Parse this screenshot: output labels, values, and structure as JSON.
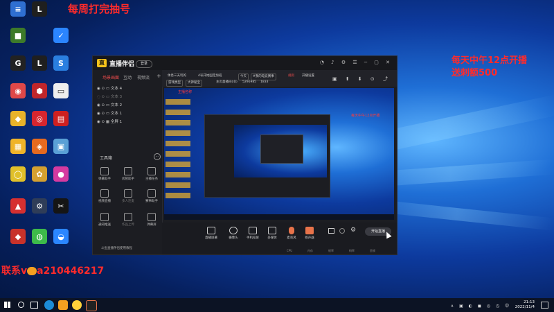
{
  "overlays": {
    "top_text": "每周打完抽号",
    "right_line1": "每天中午12点开播",
    "right_line2": "送刺额500",
    "bottom_prefix": "联系v",
    "bottom_suffix": "a210446217"
  },
  "desktop_icons": [
    {
      "label": "",
      "color": "#2f6fd1",
      "glyph": "≡"
    },
    {
      "label": "",
      "color": "#1f1f1f",
      "glyph": "L"
    },
    {
      "label": "",
      "color": "#3d7a2a",
      "glyph": "■"
    },
    {
      "label": "",
      "color": "#2b85ff",
      "glyph": "✓"
    },
    {
      "label": "",
      "color": "#222222",
      "glyph": "G"
    },
    {
      "label": "",
      "color": "#1f1f1f",
      "glyph": "L"
    },
    {
      "label": "",
      "color": "#2a7fe0",
      "glyph": "S"
    },
    {
      "label": "",
      "color": "#e04848",
      "glyph": "◉"
    },
    {
      "label": "",
      "color": "#c0262b",
      "glyph": "⬢"
    },
    {
      "label": "",
      "color": "#eeeeee",
      "glyph": "▭"
    },
    {
      "label": "",
      "color": "#e8b22a",
      "glyph": "◆"
    },
    {
      "label": "",
      "color": "#d6262f",
      "glyph": "◎"
    },
    {
      "label": "",
      "color": "#ce2020",
      "glyph": "▤"
    },
    {
      "label": "",
      "color": "#f0b429",
      "glyph": "▦"
    },
    {
      "label": "",
      "color": "#e66a1f",
      "glyph": "◈"
    },
    {
      "label": "",
      "color": "#5aa0d6",
      "glyph": "▣"
    },
    {
      "label": "",
      "color": "#e0c02a",
      "glyph": "◯"
    },
    {
      "label": "",
      "color": "#d4a030",
      "glyph": "✿"
    },
    {
      "label": "",
      "color": "#d63aa0",
      "glyph": "●"
    },
    {
      "label": "",
      "color": "#d63030",
      "glyph": "▲"
    },
    {
      "label": "",
      "color": "#2f3d58",
      "glyph": "⚙"
    },
    {
      "label": "",
      "color": "#151515",
      "glyph": "✂"
    },
    {
      "label": "",
      "color": "#c8322a",
      "glyph": "◆"
    },
    {
      "label": "",
      "color": "#3dbb4a",
      "glyph": "◍"
    },
    {
      "label": "",
      "color": "#2b86ff",
      "glyph": "◒"
    }
  ],
  "app": {
    "name": "直播伴侣",
    "login": "登录",
    "tabs": [
      "场景画面",
      "互动",
      "视频流"
    ],
    "scenes": [
      "文本 4",
      "文本 3",
      "文本 2",
      "文本 1",
      "全屏 1"
    ],
    "toolbox_title": "工具箱",
    "tools": [
      {
        "label": "弹幕助手"
      },
      {
        "label": "房管助手"
      },
      {
        "label": "主播任务"
      },
      {
        "label": "视频直播"
      },
      {
        "label": "多人连麦"
      },
      {
        "label": "赛事助手"
      },
      {
        "label": "通知推送"
      },
      {
        "label": "作品上传"
      },
      {
        "label": "弹幕屏"
      }
    ],
    "toolbox_footer": "斗鱼直播伴侣使用教程",
    "info_tags": [
      "休息三天玩的",
      "4号开始固定加班",
      "今天",
      "#我的电竞赛事",
      "规则",
      "开播设置"
    ],
    "info_line2": [
      "游戏类型",
      "大神秘宝",
      "主页直播间(ID)",
      "5296985",
      "1833"
    ],
    "preview_label": "主播名称",
    "preview_inner_red": "每天中午12点开播",
    "bottom_buttons": [
      "直播屏幕",
      "摄像头",
      "手机投屏",
      "多媒体",
      "麦克风",
      "扬声器"
    ],
    "start_label": "开始直播",
    "status_items": [
      "CPU",
      "内存",
      "帧率",
      "码率",
      "丢帧"
    ]
  },
  "taskbar": {
    "time": "21:13",
    "date": "2022/11/4",
    "apps": [
      "windows",
      "search",
      "task-view",
      "edge",
      "app1",
      "app2",
      "app3"
    ]
  }
}
